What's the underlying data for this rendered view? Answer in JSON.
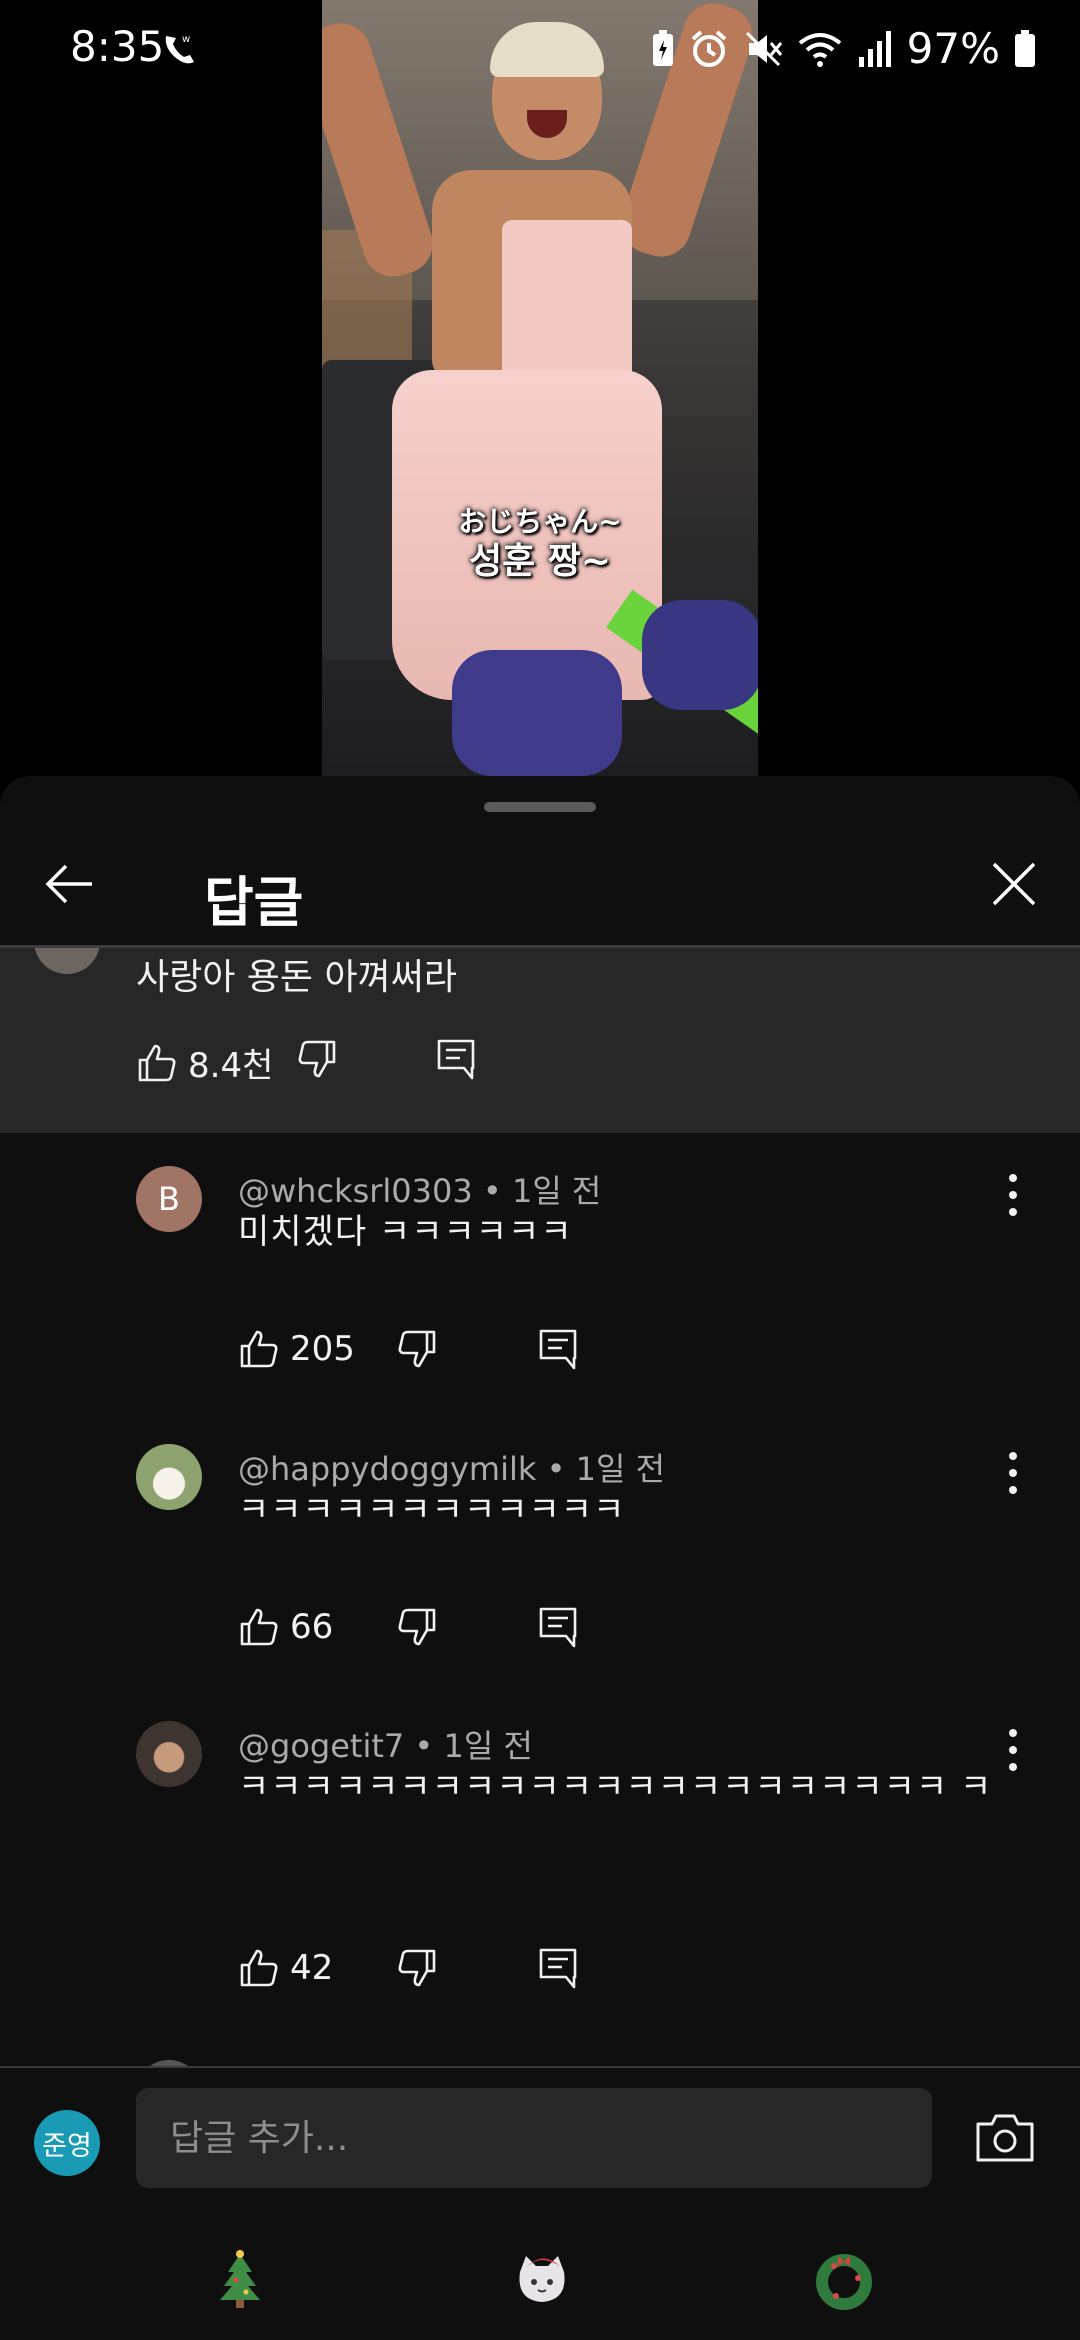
{
  "status_bar": {
    "time": "8:35",
    "battery": "97%",
    "icons": [
      "wifi-calling-icon",
      "battery-saver-icon",
      "alarm-icon",
      "mute-icon",
      "wifi-icon",
      "signal-icon",
      "battery-icon"
    ]
  },
  "video": {
    "subtitle_line1": "おじちゃん~",
    "subtitle_line2": "성훈 짱~"
  },
  "sheet": {
    "title": "답글",
    "back_icon": "arrow-left-icon",
    "close_icon": "close-icon"
  },
  "parent_comment": {
    "text": "사랑아 용돈 아껴써라",
    "likes": "8.4천"
  },
  "replies": [
    {
      "avatar_letter": "B",
      "author": "@whcksrl0303",
      "time": "1일 전",
      "text": "미치겠다 ㅋㅋㅋㅋㅋㅋ",
      "likes": "205"
    },
    {
      "avatar_letter": "",
      "author": "@happydoggymilk",
      "time": "1일 전",
      "text": "ㅋㅋㅋㅋㅋㅋㅋㅋㅋㅋㅋㅋ",
      "likes": "66"
    },
    {
      "avatar_letter": "",
      "author": "@gogetit7",
      "time": "1일 전",
      "text": "ㅋㅋㅋㅋㅋㅋㅋㅋㅋㅋㅋㅋㅋㅋㅋㅋㅋㅋㅋㅋㅋㅋ ㅋ",
      "likes": "42"
    }
  ],
  "composer": {
    "my_avatar_text": "준영",
    "placeholder": "답글 추가...",
    "camera_icon": "camera-icon"
  },
  "nav": [
    "christmas-tree-icon",
    "cat-santa-icon",
    "wreath-icon"
  ],
  "colors": {
    "sheet_bg": "#0f0f0f",
    "parent_bg": "#272727",
    "text_primary": "#f1f1f1",
    "text_secondary": "#aaaaaa",
    "my_avatar": "#1a9bb5"
  }
}
